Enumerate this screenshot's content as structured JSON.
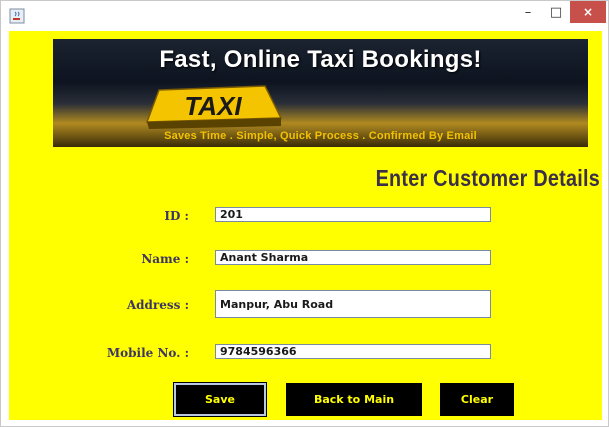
{
  "window": {
    "title_icon": "java-coffee-icon",
    "minimize": "–",
    "maximize": "□",
    "close": "×"
  },
  "banner": {
    "title": "Fast, Online Taxi Bookings!",
    "sign_text": "TAXI",
    "subtitle": "Saves Time . Simple, Quick Process . Confirmed By Email"
  },
  "form": {
    "heading": "Enter Customer Details",
    "id_label": "ID :",
    "id_value": "201",
    "name_label": "Name :",
    "name_value": "Anant Sharma",
    "address_label": "Address :",
    "address_value": "Manpur, Abu Road",
    "mobile_label": "Mobile No. :",
    "mobile_value": "9784596366"
  },
  "buttons": {
    "save": "Save",
    "back": "Back to Main",
    "clear": "Clear"
  },
  "colors": {
    "background": "#ffff00",
    "button_bg": "#000000",
    "button_text": "#ffff00",
    "label_text": "#3d3565"
  }
}
